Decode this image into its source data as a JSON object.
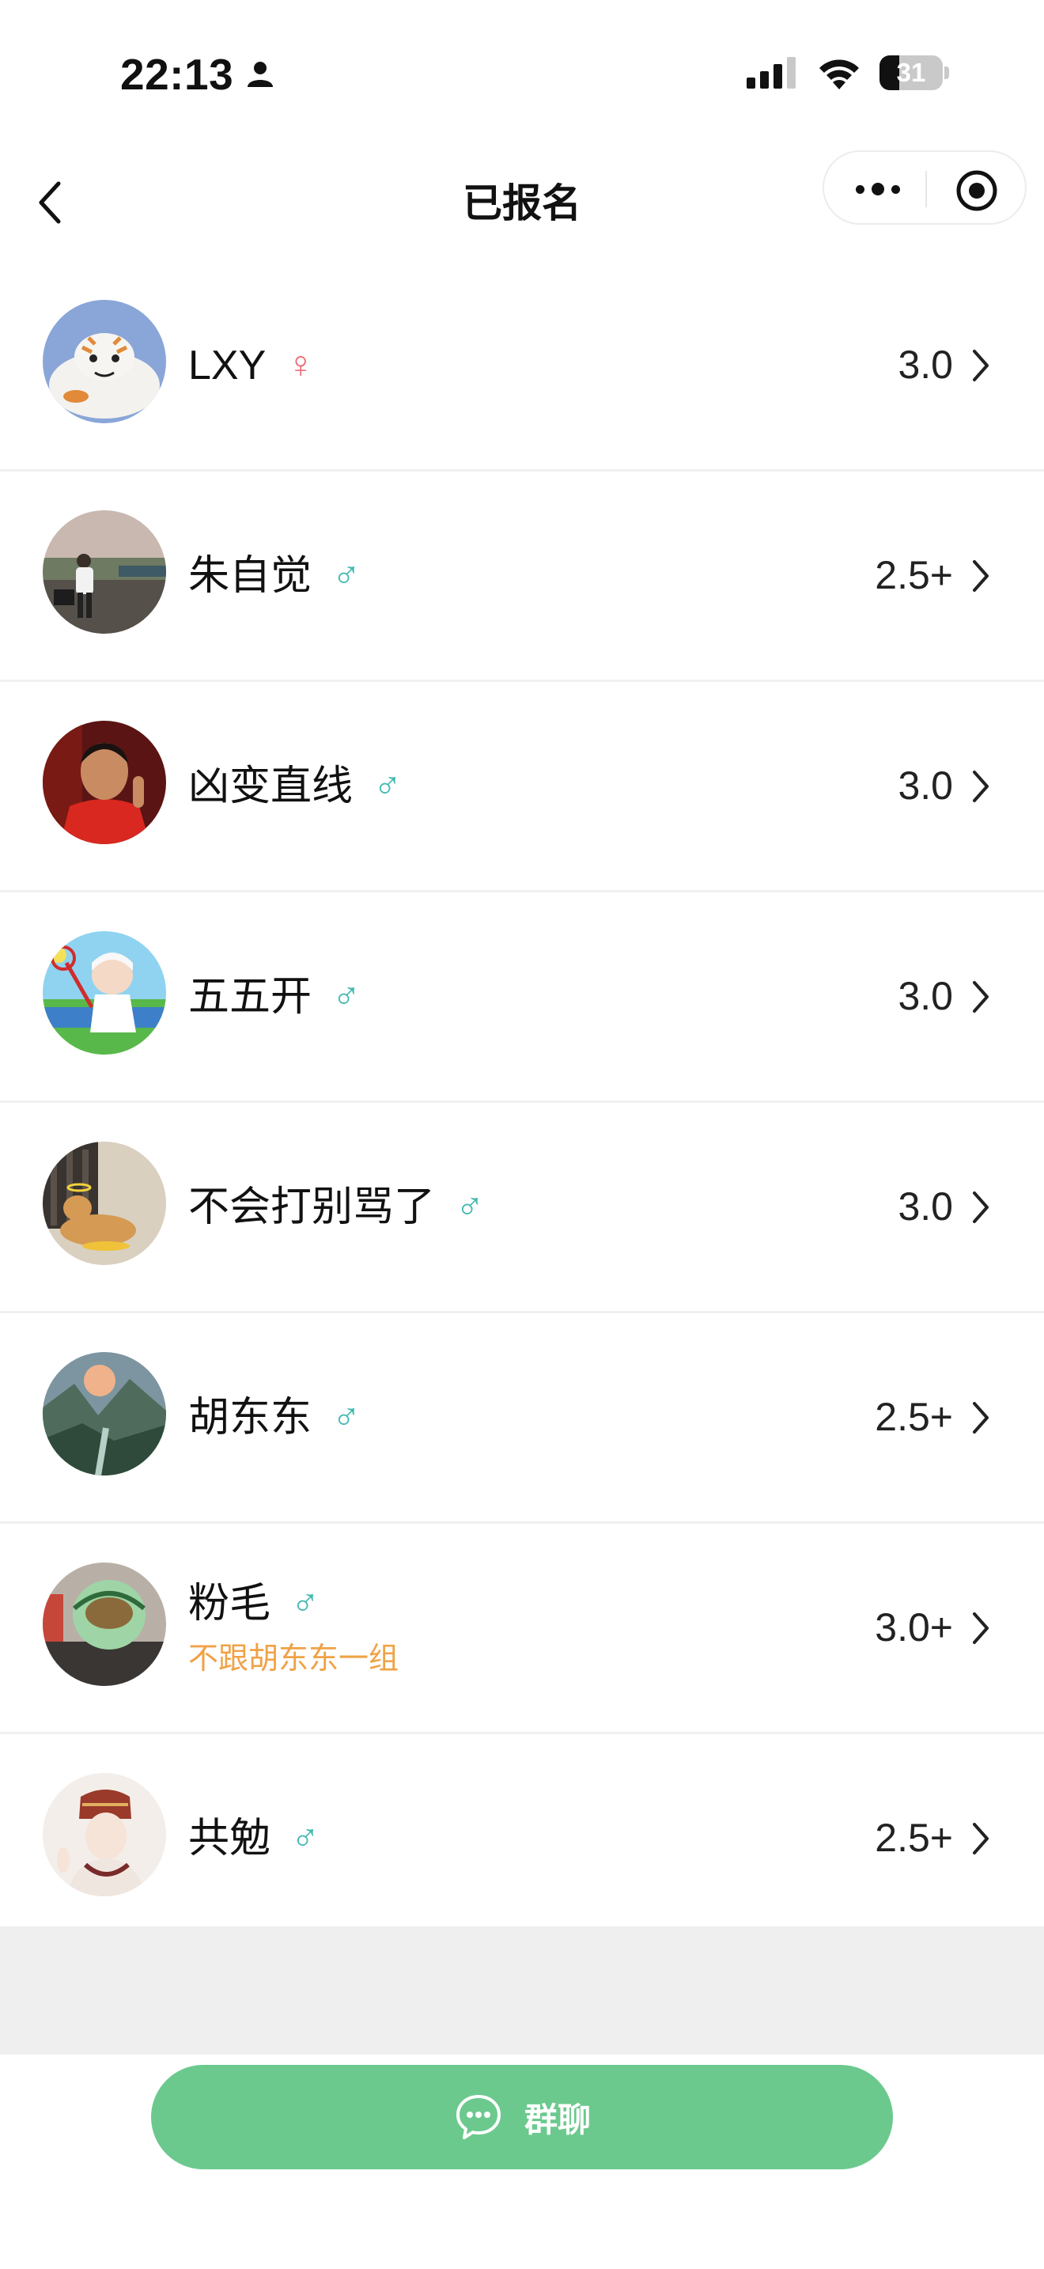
{
  "status_bar": {
    "time": "22:13",
    "battery": "31",
    "battery_level_percent": 31,
    "icons": [
      "person-icon",
      "cellular-signal-icon",
      "wifi-icon",
      "battery-icon"
    ]
  },
  "nav": {
    "title": "已报名",
    "icons": [
      "back-arrow-icon",
      "more-dots-icon",
      "target-record-icon"
    ]
  },
  "participants": [
    {
      "name": "LXY",
      "gender": "♀",
      "level": "3.0",
      "note": ""
    },
    {
      "name": "朱自觉",
      "gender": "♂",
      "level": "2.5+",
      "note": ""
    },
    {
      "name": "凶变直线",
      "gender": "♂",
      "level": "3.0",
      "note": ""
    },
    {
      "name": "五五开",
      "gender": "♂",
      "level": "3.0",
      "note": ""
    },
    {
      "name": "不会打别骂了",
      "gender": "♂",
      "level": "3.0",
      "note": ""
    },
    {
      "name": "胡东东",
      "gender": "♂",
      "level": "2.5+",
      "note": ""
    },
    {
      "name": "粉毛",
      "gender": "♂",
      "level": "3.0+",
      "note": "不跟胡东东一组"
    },
    {
      "name": "共勉",
      "gender": "♂",
      "level": "2.5+",
      "note": ""
    }
  ],
  "footer": {
    "group_chat_label": "群聊",
    "icon": "chat-bubble-icon"
  },
  "colors": {
    "accent_green": "#6cc98e",
    "male": "#41b8b0",
    "female": "#ec6f77",
    "note": "#f0a247"
  }
}
